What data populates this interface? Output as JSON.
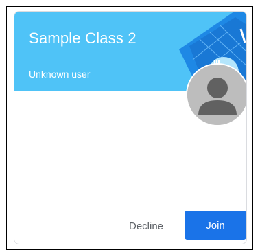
{
  "class_card": {
    "title": "Sample Class 2",
    "owner": "Unknown user",
    "banner_color": "#4fc3f7",
    "avatar_icon": "default-avatar-icon",
    "decline_label": "Decline",
    "join_label": "Join",
    "accent": "#1a73e8"
  }
}
